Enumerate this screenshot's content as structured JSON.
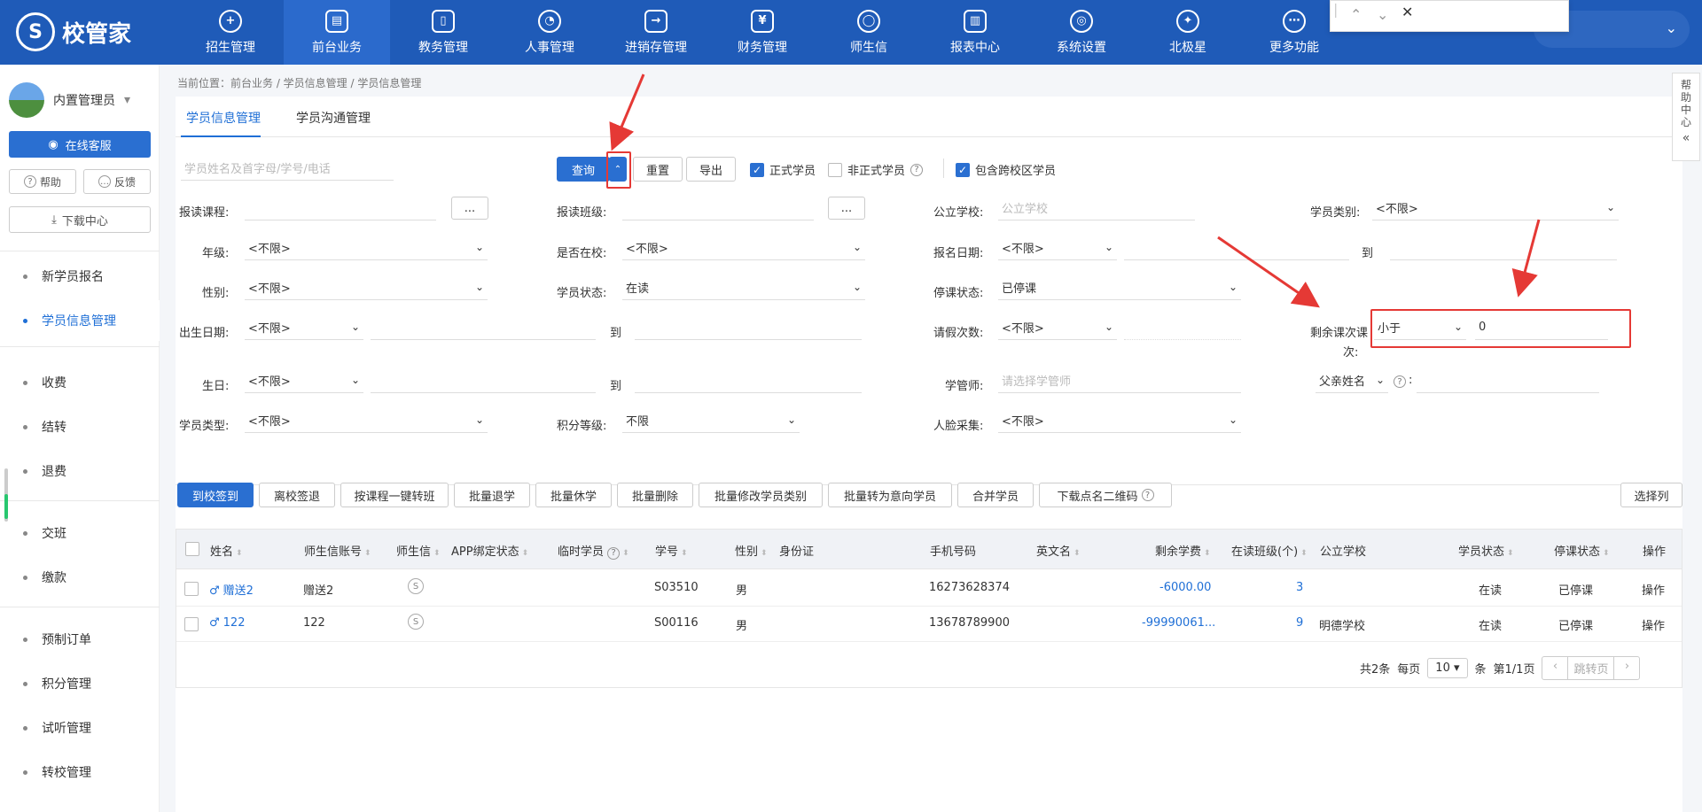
{
  "app": {
    "logo_text": "校管家"
  },
  "nav": [
    {
      "label": "招生管理",
      "icon": "+"
    },
    {
      "label": "前台业务",
      "icon": "▤"
    },
    {
      "label": "教务管理",
      "icon": "▯"
    },
    {
      "label": "人事管理",
      "icon": "◔"
    },
    {
      "label": "进销存管理",
      "icon": "→"
    },
    {
      "label": "财务管理",
      "icon": "¥"
    },
    {
      "label": "师生信",
      "icon": "◯"
    },
    {
      "label": "报表中心",
      "icon": "▥"
    },
    {
      "label": "系统设置",
      "icon": "◎"
    },
    {
      "label": "北极星",
      "icon": "✦"
    },
    {
      "label": "更多功能",
      "icon": "⋯"
    }
  ],
  "sidebar": {
    "user_name": "内置管理员",
    "service_btn": "在线客服",
    "help_btn": "帮助",
    "feedback_btn": "反馈",
    "download_btn": "下载中心",
    "items": [
      "新学员报名",
      "学员信息管理",
      "收费",
      "结转",
      "退费",
      "交班",
      "缴款",
      "预制订单",
      "积分管理",
      "试听管理",
      "转校管理"
    ]
  },
  "breadcrumb": "当前位置：前台业务 / 学员信息管理 / 学员信息管理",
  "tabs": [
    "学员信息管理",
    "学员沟通管理"
  ],
  "search": {
    "placeholder": "学员姓名及首字母/学号/电话",
    "query_btn": "查询",
    "reset_btn": "重置",
    "export_btn": "导出",
    "chk_formal": "正式学员",
    "chk_informal": "非正式学员",
    "chk_cross": "包含跨校区学员"
  },
  "filters": {
    "course_lbl": "报读课程:",
    "class_lbl": "报读班级:",
    "school_lbl": "公立学校:",
    "school_ph": "公立学校",
    "type_lbl": "学员类别:",
    "type_val": "<不限>",
    "grade_lbl": "年级:",
    "grade_val": "<不限>",
    "inschool_lbl": "是否在校:",
    "inschool_val": "<不限>",
    "regdate_lbl": "报名日期:",
    "regdate_val": "<不限>",
    "to": "到",
    "gender_lbl": "性别:",
    "gender_val": "<不限>",
    "status_lbl": "学员状态:",
    "status_val": "在读",
    "suspend_lbl": "停课状态:",
    "suspend_val": "已停课",
    "birth_lbl": "出生日期:",
    "birth_val": "<不限>",
    "leave_lbl": "请假次数:",
    "leave_val": "<不限>",
    "remain_lbl1": "剩余课次课",
    "remain_lbl2": "次:",
    "remain_op": "小于",
    "remain_val": "0",
    "bday_lbl": "生日:",
    "bday_val": "<不限>",
    "teacher_lbl": "学管师:",
    "teacher_ph": "请选择学管师",
    "father_lbl": "父亲姓名",
    "stype_lbl": "学员类型:",
    "stype_val": "<不限>",
    "points_lbl": "积分等级:",
    "points_val": "不限",
    "face_lbl": "人脸采集:",
    "face_val": "<不限>"
  },
  "actions": [
    "到校签到",
    "离校签退",
    "按课程一键转班",
    "批量退学",
    "批量休学",
    "批量删除",
    "批量修改学员类别",
    "批量转为意向学员",
    "合并学员",
    "下载点名二维码"
  ],
  "choose_cols": "选择列",
  "table": {
    "headers": [
      "姓名",
      "师生信账号",
      "师生信",
      "APP绑定状态",
      "临时学员",
      "学号",
      "性别",
      "身份证",
      "手机号码",
      "英文名",
      "剩余学费",
      "在读班级(个)",
      "公立学校",
      "学员状态",
      "停课状态",
      "操作"
    ],
    "rows": [
      {
        "name": "赠送2",
        "account": "赠送2",
        "no": "S03510",
        "gender": "男",
        "phone": "16273628374",
        "fee": "-6000.00",
        "classes": "3",
        "school": "",
        "status": "在读",
        "suspend": "已停课",
        "op": "操作"
      },
      {
        "name": "122",
        "account": "122",
        "no": "S00116",
        "gender": "男",
        "phone": "13678789900",
        "fee": "-99990061...",
        "classes": "9",
        "school": "明德学校",
        "status": "在读",
        "suspend": "已停课",
        "op": "操作"
      }
    ]
  },
  "pager": {
    "total": "共2条",
    "per": "每页",
    "size": "10",
    "unit": "条",
    "page": "第1/1页",
    "jump": "跳转页"
  },
  "help_panel": "帮助中心"
}
